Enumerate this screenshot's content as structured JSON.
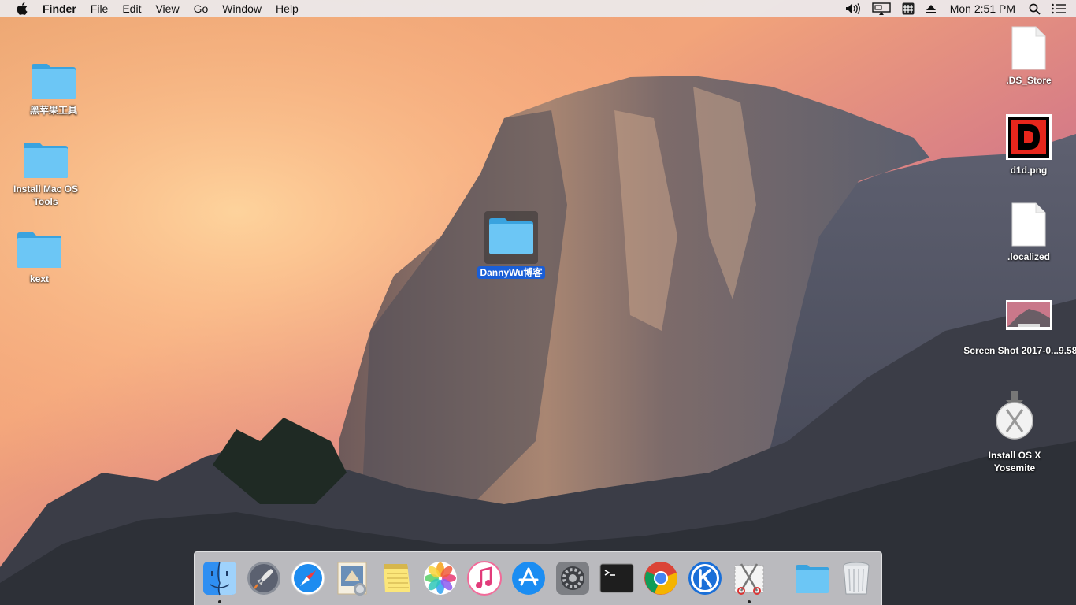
{
  "menubar": {
    "app_name": "Finder",
    "menus": [
      "File",
      "Edit",
      "View",
      "Go",
      "Window",
      "Help"
    ],
    "status_icons": [
      "volume-icon",
      "airplay-icon",
      "input-source-icon",
      "eject-icon"
    ],
    "clock": "Mon 2:51 PM"
  },
  "desktop": {
    "left_items": [
      {
        "label": "黑苹果工具",
        "type": "folder"
      },
      {
        "label": "Install Mac OS Tools",
        "type": "folder"
      },
      {
        "label": "kext",
        "type": "folder"
      }
    ],
    "center_item": {
      "label": "DannyWu博客",
      "type": "folder",
      "selected": true
    },
    "right_items": [
      {
        "label": ".DS_Store",
        "type": "document"
      },
      {
        "label": "d1d.png",
        "type": "image",
        "glyph": "D"
      },
      {
        "label": ".localized",
        "type": "document"
      },
      {
        "label": "Screen Shot 2017-0...9.58 PM",
        "type": "screenshot"
      },
      {
        "label": "Install OS X Yosemite",
        "type": "installer"
      }
    ]
  },
  "dock": {
    "apps": [
      "Finder",
      "Launchpad",
      "Safari",
      "Mail",
      "Notes",
      "Photos",
      "iTunes",
      "App Store",
      "System Preferences",
      "Terminal",
      "Google Chrome",
      "K App",
      "Scissors Tool"
    ],
    "running": [
      "Finder",
      "Scissors Tool"
    ],
    "stacks": [
      "Documents Folder",
      "Trash"
    ]
  },
  "colors": {
    "folder_blue": "#5ec0f4",
    "selection_blue": "#1a5ed6",
    "sky_top": "#c86a8e",
    "sky_mid": "#f0a070"
  }
}
